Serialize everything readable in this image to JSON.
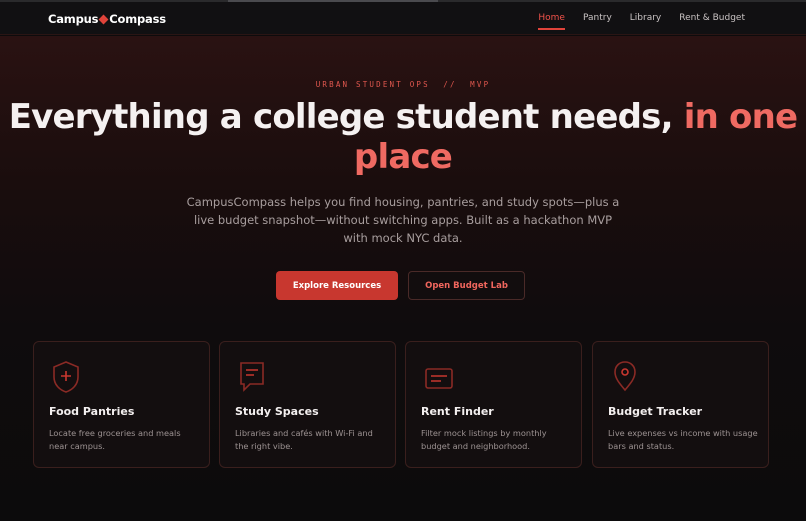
{
  "nav": {
    "brand_left": "Campus",
    "brand_right": "Compass",
    "links": [
      "Home",
      "Pantry",
      "Library",
      "Rent & Budget"
    ],
    "active": "Home"
  },
  "hero": {
    "eyebrow": "URBAN STUDENT OPS  //  MVP",
    "headline_main": "Everything a college student needs, ",
    "headline_accent": "in one place",
    "subtitle": "CampusCompass helps you find housing, pantries, and study spots—plus a live budget snapshot—without switching apps. Built as a hackathon MVP with mock NYC data.",
    "primary_button": "Explore Resources",
    "secondary_button": "Open Budget Lab"
  },
  "cards": [
    {
      "icon": "shield-plus-icon",
      "title": "Food Pantries",
      "desc": "Locate free groceries and meals near campus."
    },
    {
      "icon": "document-icon",
      "title": "Study Spaces",
      "desc": "Libraries and cafés with Wi-Fi and the right vibe."
    },
    {
      "icon": "card-icon",
      "title": "Rent Finder",
      "desc": "Filter mock listings by monthly budget and neighborhood."
    },
    {
      "icon": "map-pin-icon",
      "title": "Budget Tracker",
      "desc": "Live expenses vs income with usage bars and status."
    }
  ],
  "colors": {
    "accent": "#e0433a",
    "accent_text": "#ef6a62",
    "background": "#0d0b0c"
  }
}
